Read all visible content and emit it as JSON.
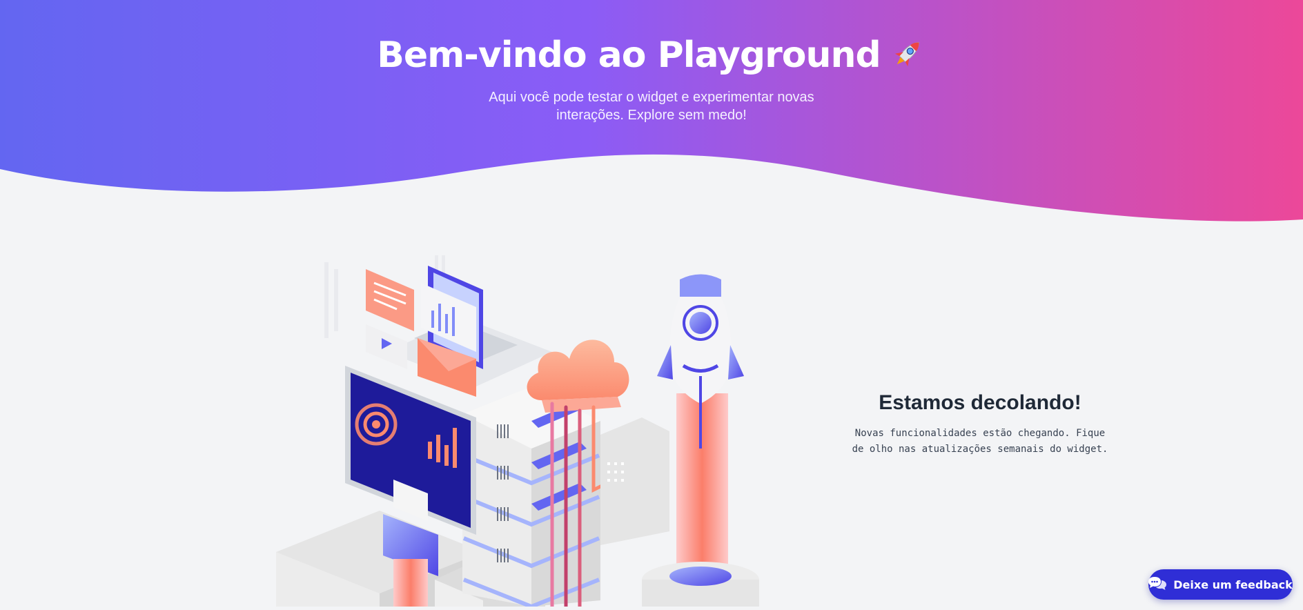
{
  "hero": {
    "title": "Bem-vindo ao Playground",
    "title_icon": "rocket-emoji-icon",
    "subtitle": "Aqui você pode testar o widget e experimentar novas interações. Explore sem medo!",
    "gradient": [
      "#6366f1",
      "#8b5cf6",
      "#ec4899"
    ]
  },
  "illustration": {
    "icon": "isometric-cloud-server-rocket-illustration"
  },
  "info": {
    "heading": "Estamos decolando!",
    "text": "Novas funcionalidades estão chegando. Fique de olho nas atualizações semanais do widget."
  },
  "feedback": {
    "label": "Deixe um feedback",
    "icon": "chat-bubble-icon",
    "color": "#2f2ed6"
  }
}
